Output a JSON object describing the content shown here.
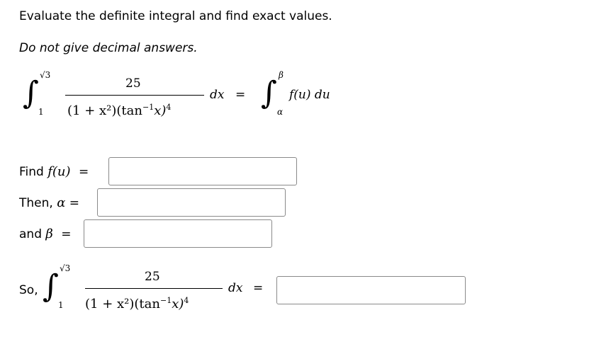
{
  "instruction": "Evaluate the definite integral and find exact values.",
  "note": "Do not give decimal answers.",
  "integral": {
    "lower": "1",
    "upper": "√3",
    "numerator": "25",
    "denominator_main": "(1 + x²)(tan",
    "denominator_sup": "−1",
    "denominator_arg": "x)",
    "denominator_exp": "4",
    "differential": "dx",
    "equals": "=",
    "sub_upper": "β",
    "sub_lower": "α",
    "sub_integrand": "f(u) du"
  },
  "questions": {
    "find_prefix": "Find",
    "find_expr": "f(u)",
    "then_prefix": "Then,",
    "alpha": "α",
    "and_prefix": "and",
    "beta": "β",
    "eq": "=",
    "so_prefix": "So,"
  },
  "inputs": {
    "f_value": "",
    "alpha_value": "",
    "beta_value": "",
    "result_value": ""
  }
}
